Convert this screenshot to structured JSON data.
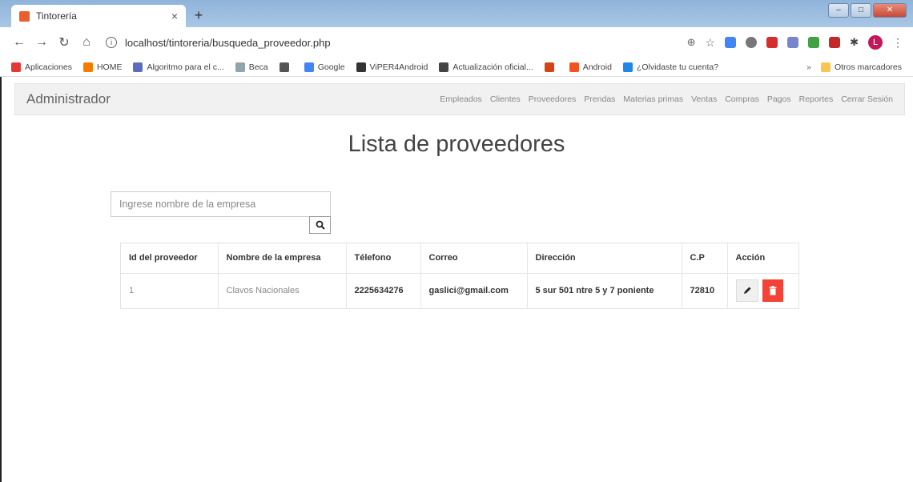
{
  "browser": {
    "tab_title": "Tintorería",
    "tab_close": "×",
    "new_tab": "+",
    "url": "localhost/tintoreria/busqueda_proveedor.php",
    "profile_initial": "L",
    "bookmarks": [
      {
        "label": "Aplicaciones",
        "color": "#e53935"
      },
      {
        "label": "HOME",
        "color": "#f57c00"
      },
      {
        "label": "Algoritmo para el c...",
        "color": "#5c6bc0"
      },
      {
        "label": "Beca",
        "color": "#90a4ae"
      },
      {
        "label": "",
        "color": "#555555"
      },
      {
        "label": "Google",
        "color": "#4285f4"
      },
      {
        "label": "ViPER4Android",
        "color": "#333333"
      },
      {
        "label": "Actualización oficial...",
        "color": "#444444"
      },
      {
        "label": "",
        "color": "#d84315"
      },
      {
        "label": "Android",
        "color": "#f4511e"
      },
      {
        "label": "¿Olvidaste tu cuenta?",
        "color": "#1e88e5"
      }
    ],
    "bookmarks_overflow": "»",
    "other_bookmarks": "Otros marcadores"
  },
  "nav": {
    "brand": "Administrador",
    "links": [
      "Empleados",
      "Clientes",
      "Proveedores",
      "Prendas",
      "Materias primas",
      "Ventas",
      "Compras",
      "Pagos",
      "Reportes",
      "Cerrar Sesión"
    ]
  },
  "page": {
    "title": "Lista de proveedores",
    "search_placeholder": "Ingrese nombre de la empresa"
  },
  "table": {
    "headers": [
      "Id del proveedor",
      "Nombre de la empresa",
      "Télefono",
      "Correo",
      "Dirección",
      "C.P",
      "Acción"
    ],
    "rows": [
      {
        "id": "1",
        "empresa": "Clavos Nacionales",
        "telefono": "2225634276",
        "correo": "gaslici@gmail.com",
        "direccion": "5 sur 501 ntre 5 y 7 poniente",
        "cp": "72810"
      }
    ]
  },
  "colors": {
    "delete": "#f44336",
    "navbar": "#f1f1f1"
  }
}
